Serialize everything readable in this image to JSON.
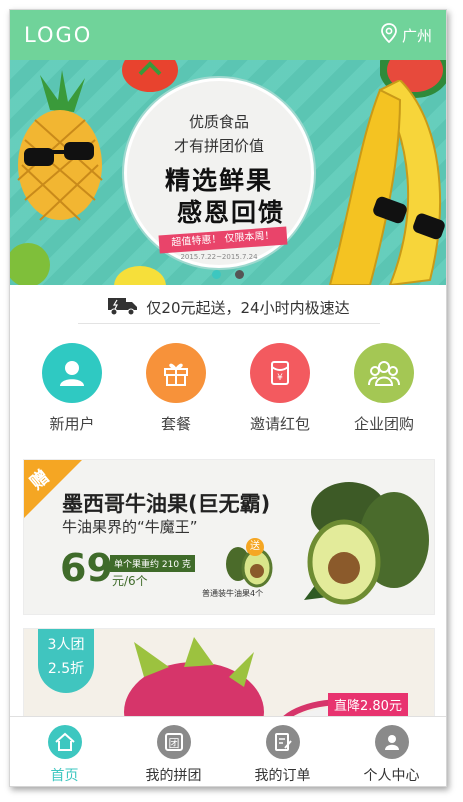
{
  "header": {
    "logo": "LOGO",
    "city": "广州",
    "location_icon": "map-pin-icon"
  },
  "banner": {
    "line1": "优质食品",
    "line2": "才有拼团价值",
    "headline1": "精选鲜果",
    "headline2": "感恩回馈",
    "promo": "超值特惠！ 仅限本周！",
    "dates": "2015.7.22~2015.7.24",
    "slides": 2,
    "active_slide": 1
  },
  "notice": {
    "icon": "delivery-truck-icon",
    "text": "仅20元起送，24小时内极速达"
  },
  "menu": [
    {
      "label": "新用户",
      "icon": "user-icon",
      "color": "#2fc9c2"
    },
    {
      "label": "套餐",
      "icon": "gift-icon",
      "color": "#f7923a"
    },
    {
      "label": "邀请红包",
      "icon": "red-envelope-icon",
      "color": "#f35a5f"
    },
    {
      "label": "企业团购",
      "icon": "group-icon",
      "color": "#a4c754"
    }
  ],
  "product1": {
    "badge": "赠",
    "title": "墨西哥牛油果(巨无霸)",
    "subtitle": "牛油果界的“牛魔王”",
    "price": "69",
    "tag": "单个果重约 210 克",
    "unit": "元/6个",
    "send_badge": "送",
    "note": "普通装牛油果4个"
  },
  "product2": {
    "badge_line1": "3人团",
    "badge_line2": "2.5折",
    "price_drop": "直降2.80元"
  },
  "tabbar": [
    {
      "label": "首页",
      "icon": "home-icon",
      "active": true
    },
    {
      "label": "我的拼团",
      "icon": "group-order-icon",
      "active": false
    },
    {
      "label": "我的订单",
      "icon": "order-edit-icon",
      "active": false
    },
    {
      "label": "个人中心",
      "icon": "profile-icon",
      "active": false
    }
  ],
  "colors": {
    "accent": "#70d39a",
    "teal": "#3dc7c0",
    "pink": "#e8336f"
  }
}
